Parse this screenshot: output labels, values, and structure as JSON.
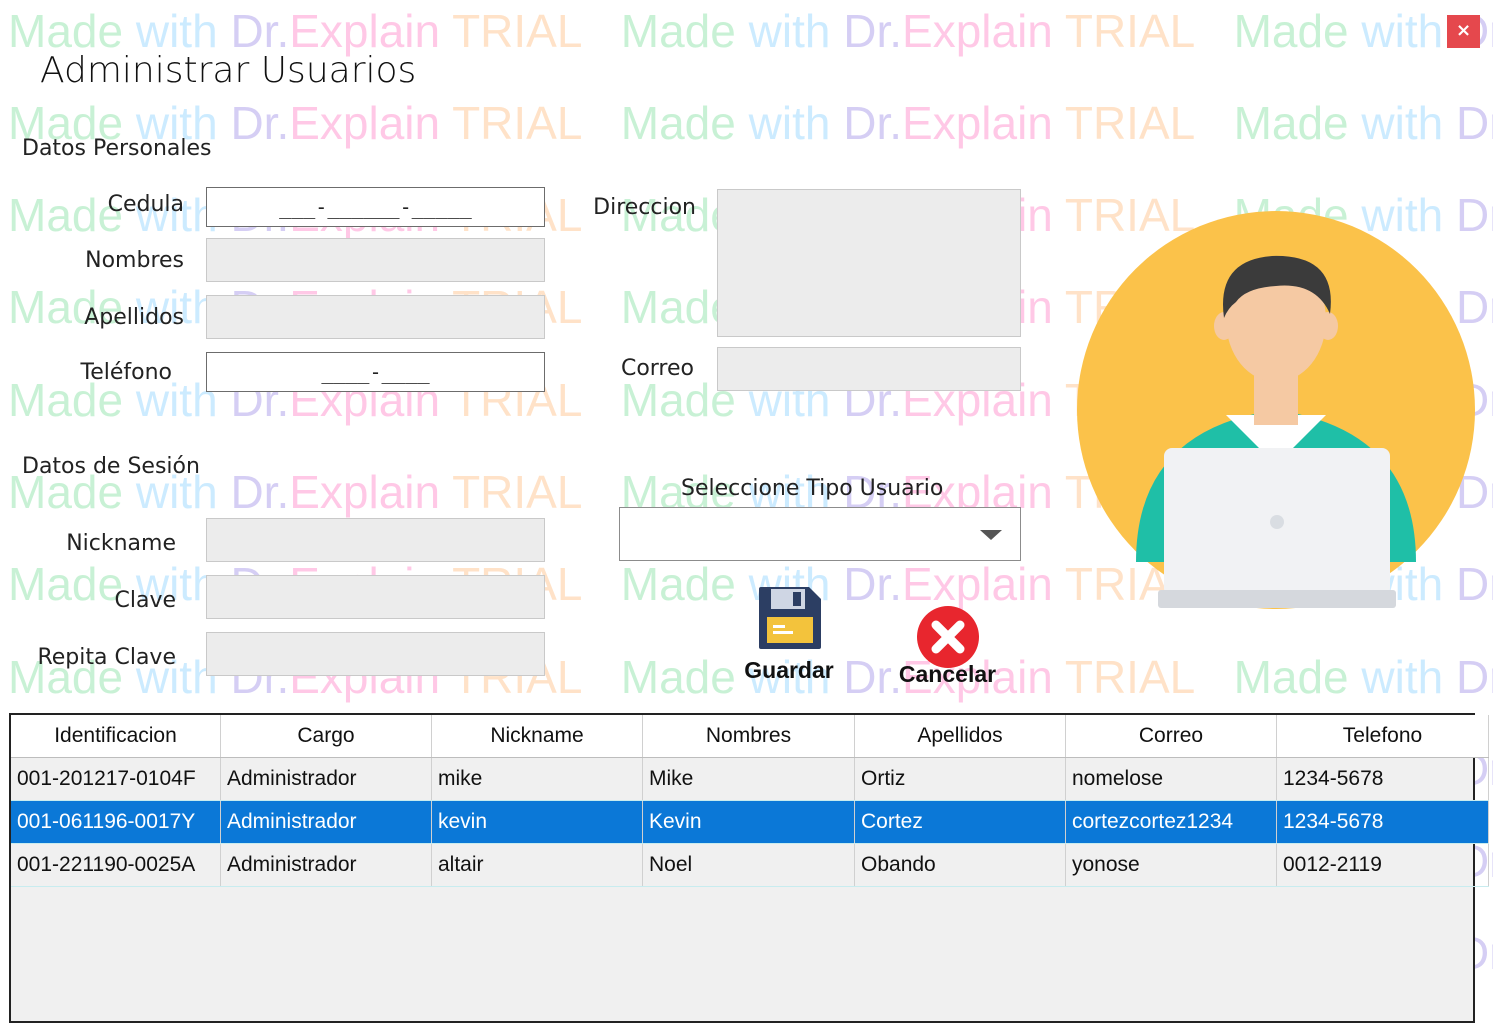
{
  "window": {
    "title": "Administrar Usuarios",
    "close_glyph": "×"
  },
  "watermark": {
    "made": "Made",
    "with": "with",
    "dr": "Dr.",
    "explain": "Explain",
    "trial": "TRIAL"
  },
  "personal": {
    "section_label": "Datos Personales",
    "cedula_label": "Cedula",
    "cedula_mask": "___-______-_____",
    "nombres_label": "Nombres",
    "apellidos_label": "Apellidos",
    "telefono_label": "Teléfono",
    "telefono_mask": "____-____",
    "direccion_label": "Direccion",
    "correo_label": "Correo"
  },
  "session": {
    "section_label": "Datos de Sesión",
    "nickname_label": "Nickname",
    "clave_label": "Clave",
    "repita_clave_label": "Repita Clave",
    "tipo_usuario_label": "Seleccione Tipo Usuario",
    "tipo_usuario_value": ""
  },
  "actions": {
    "save_label": "Guardar",
    "cancel_label": "Cancelar"
  },
  "colors": {
    "accent": "#0b78d7",
    "avatar_bg": "#fbc24a",
    "shirt": "#1fbfa7",
    "cancel_red": "#e8262e"
  },
  "table": {
    "columns": [
      "Identificacion",
      "Cargo",
      "Nickname",
      "Nombres",
      "Apellidos",
      "Correo",
      "Telefono"
    ],
    "rows": [
      [
        "001-201217-0104F",
        "Administrador",
        "mike",
        "Mike",
        "Ortiz",
        "nomelose",
        "1234-5678"
      ],
      [
        "001-061196-0017Y",
        "Administrador",
        "kevin",
        "Kevin",
        "Cortez",
        "cortezcortez1234",
        "1234-5678"
      ],
      [
        "001-221190-0025A",
        "Administrador",
        "altair",
        "Noel",
        "Obando",
        "yonose",
        "0012-2119"
      ]
    ],
    "selected_row": 1
  }
}
